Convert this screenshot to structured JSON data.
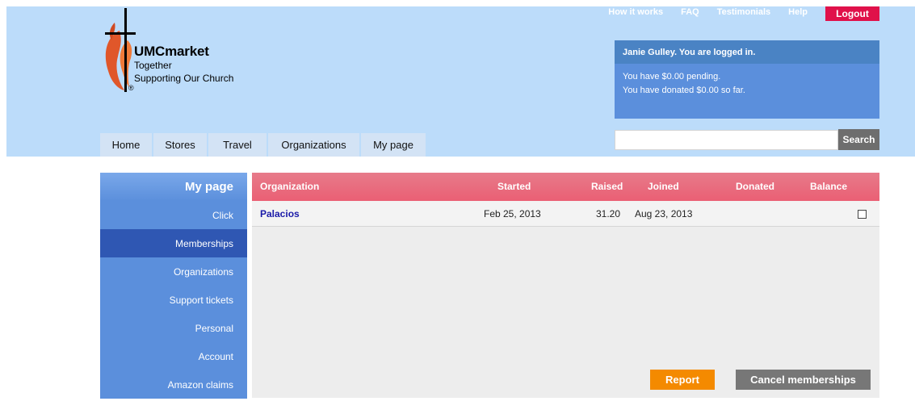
{
  "brand": {
    "name": "UMCmarket",
    "tagline_1": "Together",
    "tagline_2": "Supporting Our Church",
    "registered_mark": "®"
  },
  "top_links": {
    "how_it_works": "How it works",
    "faq": "FAQ",
    "testimonials": "Testimonials",
    "help": "Help",
    "logout": "Logout"
  },
  "user_panel": {
    "heading": "Janie Gulley. You are logged in.",
    "pending": "You have $0.00 pending.",
    "donated": "You have donated $0.00 so far."
  },
  "search": {
    "value": "",
    "button": "Search"
  },
  "nav": {
    "home": "Home",
    "stores": "Stores",
    "travel": "Travel",
    "organizations": "Organizations",
    "my_page": "My page"
  },
  "sidebar": {
    "title": "My page",
    "items": {
      "click": "Click",
      "memberships": "Memberships",
      "organizations": "Organizations",
      "support_tickets": "Support tickets",
      "personal": "Personal",
      "account": "Account",
      "amazon_claims": "Amazon claims"
    },
    "active": "memberships"
  },
  "memberships_table": {
    "columns": {
      "organization": "Organization",
      "started": "Started",
      "raised": "Raised",
      "joined": "Joined",
      "donated": "Donated",
      "balance": "Balance"
    },
    "rows": [
      {
        "organization": "Palacios",
        "started": "Feb 25, 2013",
        "raised": "31.20",
        "joined": "Aug 23, 2013",
        "donated": "",
        "balance": "",
        "checked": false
      }
    ]
  },
  "actions": {
    "report": "Report",
    "cancel_memberships": "Cancel memberships"
  },
  "colors": {
    "header_bg": "#bcdcfa",
    "logout": "#e0114a",
    "sidebar": "#5b8fdc",
    "sidebar_active": "#2f57b3",
    "table_header": "#ea5f74",
    "report": "#f48a00",
    "cancel": "#777777"
  }
}
